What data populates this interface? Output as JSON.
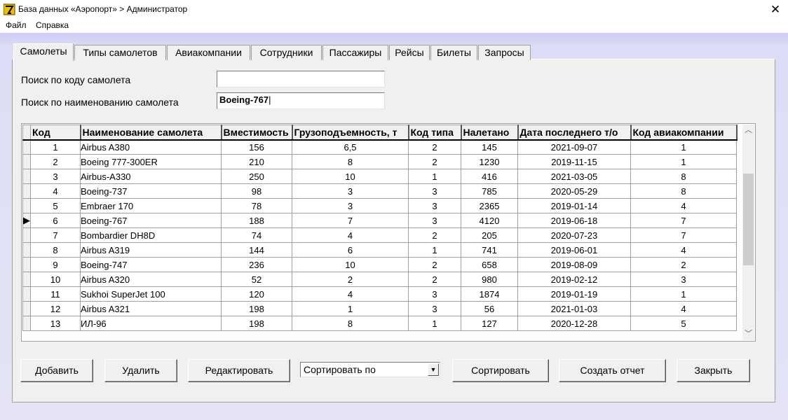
{
  "window": {
    "title": "База данных «Аэропорт» > Администратор",
    "close_glyph": "✕"
  },
  "menu": {
    "items": [
      "Файл",
      "Справка"
    ]
  },
  "tabs": [
    "Самолеты",
    "Типы самолетов",
    "Авиакомпании",
    "Сотрудники",
    "Пассажиры",
    "Рейсы",
    "Билеты",
    "Запросы"
  ],
  "search": {
    "by_code_label": "Поиск по коду самолета",
    "by_code_value": "",
    "by_name_label": "Поиск по наименованию самолета",
    "by_name_value": "Boeing-767"
  },
  "table": {
    "columns": [
      "Код",
      "Наименование самолета",
      "Вместимость",
      "Грузоподъемность, т",
      "Код типа",
      "Налетано",
      "Дата последнего т/о",
      "Код авиакомпании"
    ],
    "current_row": 6,
    "rows": [
      [
        "1",
        "Airbus A380",
        "156",
        "6,5",
        "2",
        "145",
        "2021-09-07",
        "1"
      ],
      [
        "2",
        "Boeing 777-300ER",
        "210",
        "8",
        "2",
        "1230",
        "2019-11-15",
        "1"
      ],
      [
        "3",
        "Airbus-A330",
        "250",
        "10",
        "1",
        "416",
        "2021-03-05",
        "8"
      ],
      [
        "4",
        "Boeing-737",
        "98",
        "3",
        "3",
        "785",
        "2020-05-29",
        "8"
      ],
      [
        "5",
        "Embraer 170",
        "78",
        "3",
        "3",
        "2365",
        "2019-01-14",
        "4"
      ],
      [
        "6",
        "Boeing-767",
        "188",
        "7",
        "3",
        "4120",
        "2019-06-18",
        "7"
      ],
      [
        "7",
        "Bombardier DH8D",
        "74",
        "4",
        "2",
        "205",
        "2020-07-23",
        "7"
      ],
      [
        "8",
        "Airbus A319",
        "144",
        "6",
        "1",
        "741",
        "2019-06-01",
        "4"
      ],
      [
        "9",
        "Boeing-747",
        "236",
        "10",
        "2",
        "658",
        "2019-08-09",
        "2"
      ],
      [
        "10",
        "Airbus A320",
        "52",
        "2",
        "2",
        "980",
        "2019-02-12",
        "3"
      ],
      [
        "11",
        "Sukhoi SuperJet 100",
        "120",
        "4",
        "3",
        "1874",
        "2019-01-19",
        "1"
      ],
      [
        "12",
        "Airbus A321",
        "198",
        "1",
        "3",
        "56",
        "2021-01-03",
        "4"
      ],
      [
        "13",
        "ИЛ-96",
        "198",
        "8",
        "1",
        "127",
        "2020-12-28",
        "5"
      ]
    ]
  },
  "buttons": {
    "add": "Добавить",
    "delete": "Удалить",
    "edit": "Редактировать",
    "sort_combo": "Сортировать по",
    "sort": "Сортировать",
    "report": "Создать отчет",
    "close": "Закрыть"
  }
}
